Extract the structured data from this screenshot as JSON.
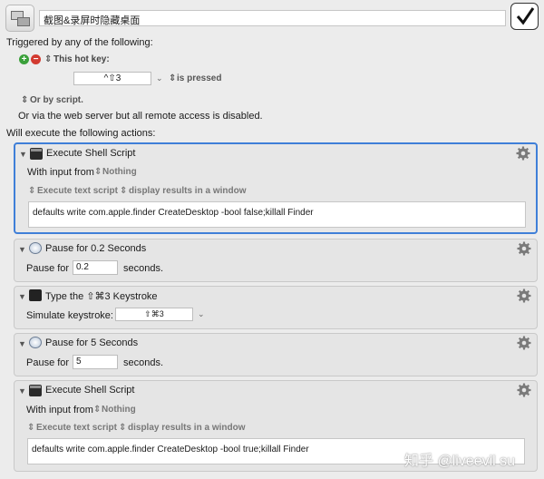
{
  "header": {
    "macro_name": "截图&录屏时隐藏桌面"
  },
  "triggers": {
    "heading": "Triggered by any of the following:",
    "hotkey_label": "This hot key:",
    "hotkey_value": "^⇧3",
    "hotkey_condition": "is pressed",
    "or_by_script": "Or by script.",
    "web_server_note": "Or via the web server but all remote access is disabled."
  },
  "actions_heading": "Will execute the following actions:",
  "actions": [
    {
      "title": "Execute Shell Script",
      "with_input_label": "With input from",
      "with_input_value": "Nothing",
      "mode": "Execute text script",
      "output": "display results in a window",
      "script": "defaults write com.apple.finder CreateDesktop -bool false;killall Finder"
    },
    {
      "title": "Pause for 0.2 Seconds",
      "pause_label": "Pause for",
      "value": "0.2",
      "unit": "seconds."
    },
    {
      "title": "Type the ⇧⌘3 Keystroke",
      "simulate_label": "Simulate keystroke:",
      "keystroke": "⇧⌘3"
    },
    {
      "title": "Pause for 5 Seconds",
      "pause_label": "Pause for",
      "value": "5",
      "unit": "seconds."
    },
    {
      "title": "Execute Shell Script",
      "with_input_label": "With input from",
      "with_input_value": "Nothing",
      "mode": "Execute text script",
      "output": "display results in a window",
      "script": "defaults write com.apple.finder CreateDesktop -bool true;killall Finder"
    }
  ],
  "watermark": "知乎 @liveevil su",
  "colors": {
    "selection_border": "#3f7fd8",
    "add_green": "#3aa03a",
    "remove_red": "#d23a30"
  },
  "icons": [
    "macro-app-icon",
    "checkmark-icon",
    "add-icon",
    "remove-icon",
    "shell-script-icon",
    "clock-icon",
    "keystroke-icon",
    "gear-icon",
    "disclosure-triangle-icon",
    "stepper-icon",
    "chevron-down-icon"
  ]
}
